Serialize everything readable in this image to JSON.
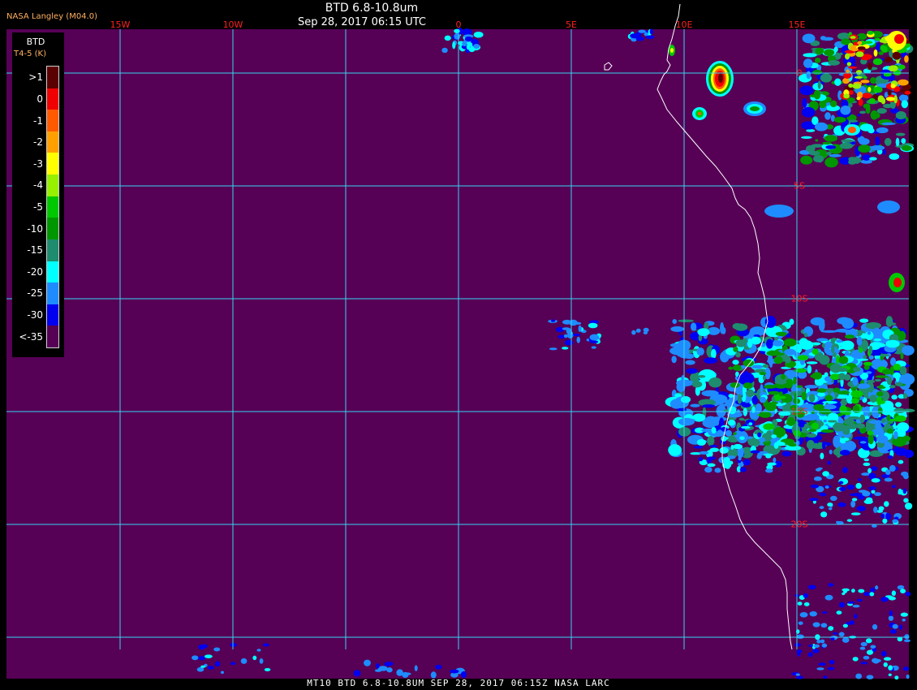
{
  "header": {
    "source": "NASA Langley (M04.0)",
    "title": "BTD 6.8-10.8um",
    "subtitle": "Sep 28, 2017 06:15 UTC"
  },
  "footer": {
    "text": "MT10  BTD 6.8-10.8UM  SEP 28, 2017 06:15Z  NASA LARC"
  },
  "map": {
    "longitude_labels": [
      {
        "label": "15W",
        "lon": -15
      },
      {
        "label": "10W",
        "lon": -10
      },
      {
        "label": "0",
        "lon": 0
      },
      {
        "label": "5E",
        "lon": 5
      },
      {
        "label": "10E",
        "lon": 10
      },
      {
        "label": "15E",
        "lon": 15
      }
    ],
    "latitude_labels": [
      {
        "label": "0",
        "lat": 0
      },
      {
        "label": "5S",
        "lat": -5
      },
      {
        "label": "10S",
        "lat": -10
      },
      {
        "label": "15S",
        "lat": -15
      },
      {
        "label": "20S",
        "lat": -20
      }
    ],
    "extent": {
      "lon_min": -20,
      "lon_max": 20,
      "lat_min": -26,
      "lat_max": 2
    },
    "colors": {
      "background": "#560056",
      "gridlines": "#36d6f0",
      "coastline": "#ffffff",
      "label_text": "#ff2020"
    }
  },
  "legend": {
    "header": "BTD",
    "units": "T4-5 (K)",
    "entries": [
      {
        "label": ">1",
        "color": "#5a0000"
      },
      {
        "label": "0",
        "color": "#f00000"
      },
      {
        "label": "-1",
        "color": "#ff5a00"
      },
      {
        "label": "-2",
        "color": "#ffa000"
      },
      {
        "label": "-3",
        "color": "#ffff00"
      },
      {
        "label": "-4",
        "color": "#96f000"
      },
      {
        "label": "-5",
        "color": "#00c800"
      },
      {
        "label": "-10",
        "color": "#009600"
      },
      {
        "label": "-15",
        "color": "#1e8c6e"
      },
      {
        "label": "-20",
        "color": "#00ffff"
      },
      {
        "label": "-25",
        "color": "#1e8cff"
      },
      {
        "label": "-30",
        "color": "#0000f0"
      },
      {
        "label": "<-35",
        "color": "#560056"
      }
    ]
  }
}
